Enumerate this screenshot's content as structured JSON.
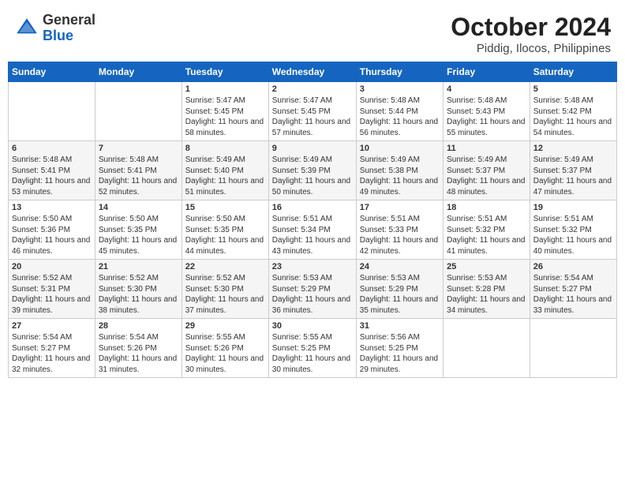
{
  "header": {
    "logo_general": "General",
    "logo_blue": "Blue",
    "month_title": "October 2024",
    "location": "Piddig, Ilocos, Philippines"
  },
  "days_of_week": [
    "Sunday",
    "Monday",
    "Tuesday",
    "Wednesday",
    "Thursday",
    "Friday",
    "Saturday"
  ],
  "weeks": [
    [
      {
        "day": "",
        "info": ""
      },
      {
        "day": "",
        "info": ""
      },
      {
        "day": "1",
        "info": "Sunrise: 5:47 AM\nSunset: 5:45 PM\nDaylight: 11 hours and 58 minutes."
      },
      {
        "day": "2",
        "info": "Sunrise: 5:47 AM\nSunset: 5:45 PM\nDaylight: 11 hours and 57 minutes."
      },
      {
        "day": "3",
        "info": "Sunrise: 5:48 AM\nSunset: 5:44 PM\nDaylight: 11 hours and 56 minutes."
      },
      {
        "day": "4",
        "info": "Sunrise: 5:48 AM\nSunset: 5:43 PM\nDaylight: 11 hours and 55 minutes."
      },
      {
        "day": "5",
        "info": "Sunrise: 5:48 AM\nSunset: 5:42 PM\nDaylight: 11 hours and 54 minutes."
      }
    ],
    [
      {
        "day": "6",
        "info": "Sunrise: 5:48 AM\nSunset: 5:41 PM\nDaylight: 11 hours and 53 minutes."
      },
      {
        "day": "7",
        "info": "Sunrise: 5:48 AM\nSunset: 5:41 PM\nDaylight: 11 hours and 52 minutes."
      },
      {
        "day": "8",
        "info": "Sunrise: 5:49 AM\nSunset: 5:40 PM\nDaylight: 11 hours and 51 minutes."
      },
      {
        "day": "9",
        "info": "Sunrise: 5:49 AM\nSunset: 5:39 PM\nDaylight: 11 hours and 50 minutes."
      },
      {
        "day": "10",
        "info": "Sunrise: 5:49 AM\nSunset: 5:38 PM\nDaylight: 11 hours and 49 minutes."
      },
      {
        "day": "11",
        "info": "Sunrise: 5:49 AM\nSunset: 5:37 PM\nDaylight: 11 hours and 48 minutes."
      },
      {
        "day": "12",
        "info": "Sunrise: 5:49 AM\nSunset: 5:37 PM\nDaylight: 11 hours and 47 minutes."
      }
    ],
    [
      {
        "day": "13",
        "info": "Sunrise: 5:50 AM\nSunset: 5:36 PM\nDaylight: 11 hours and 46 minutes."
      },
      {
        "day": "14",
        "info": "Sunrise: 5:50 AM\nSunset: 5:35 PM\nDaylight: 11 hours and 45 minutes."
      },
      {
        "day": "15",
        "info": "Sunrise: 5:50 AM\nSunset: 5:35 PM\nDaylight: 11 hours and 44 minutes."
      },
      {
        "day": "16",
        "info": "Sunrise: 5:51 AM\nSunset: 5:34 PM\nDaylight: 11 hours and 43 minutes."
      },
      {
        "day": "17",
        "info": "Sunrise: 5:51 AM\nSunset: 5:33 PM\nDaylight: 11 hours and 42 minutes."
      },
      {
        "day": "18",
        "info": "Sunrise: 5:51 AM\nSunset: 5:32 PM\nDaylight: 11 hours and 41 minutes."
      },
      {
        "day": "19",
        "info": "Sunrise: 5:51 AM\nSunset: 5:32 PM\nDaylight: 11 hours and 40 minutes."
      }
    ],
    [
      {
        "day": "20",
        "info": "Sunrise: 5:52 AM\nSunset: 5:31 PM\nDaylight: 11 hours and 39 minutes."
      },
      {
        "day": "21",
        "info": "Sunrise: 5:52 AM\nSunset: 5:30 PM\nDaylight: 11 hours and 38 minutes."
      },
      {
        "day": "22",
        "info": "Sunrise: 5:52 AM\nSunset: 5:30 PM\nDaylight: 11 hours and 37 minutes."
      },
      {
        "day": "23",
        "info": "Sunrise: 5:53 AM\nSunset: 5:29 PM\nDaylight: 11 hours and 36 minutes."
      },
      {
        "day": "24",
        "info": "Sunrise: 5:53 AM\nSunset: 5:29 PM\nDaylight: 11 hours and 35 minutes."
      },
      {
        "day": "25",
        "info": "Sunrise: 5:53 AM\nSunset: 5:28 PM\nDaylight: 11 hours and 34 minutes."
      },
      {
        "day": "26",
        "info": "Sunrise: 5:54 AM\nSunset: 5:27 PM\nDaylight: 11 hours and 33 minutes."
      }
    ],
    [
      {
        "day": "27",
        "info": "Sunrise: 5:54 AM\nSunset: 5:27 PM\nDaylight: 11 hours and 32 minutes."
      },
      {
        "day": "28",
        "info": "Sunrise: 5:54 AM\nSunset: 5:26 PM\nDaylight: 11 hours and 31 minutes."
      },
      {
        "day": "29",
        "info": "Sunrise: 5:55 AM\nSunset: 5:26 PM\nDaylight: 11 hours and 30 minutes."
      },
      {
        "day": "30",
        "info": "Sunrise: 5:55 AM\nSunset: 5:25 PM\nDaylight: 11 hours and 30 minutes."
      },
      {
        "day": "31",
        "info": "Sunrise: 5:56 AM\nSunset: 5:25 PM\nDaylight: 11 hours and 29 minutes."
      },
      {
        "day": "",
        "info": ""
      },
      {
        "day": "",
        "info": ""
      }
    ]
  ]
}
